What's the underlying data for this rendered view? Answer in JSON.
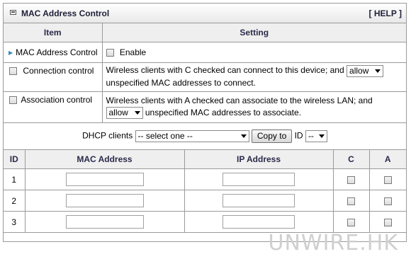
{
  "window": {
    "title": "MAC Address Control",
    "help": "[ HELP ]"
  },
  "config_table": {
    "headers": {
      "item": "Item",
      "setting": "Setting"
    },
    "mac_control": {
      "label": "MAC Address Control",
      "enable_label": "Enable"
    },
    "connection": {
      "label": "Connection control",
      "text_before": "Wireless clients with C checked can connect to this device; and",
      "select_value": "allow",
      "text_after": "unspecified MAC addresses to connect."
    },
    "association": {
      "label": "Association control",
      "text_before": "Wireless clients with A checked can associate to the wireless LAN; and",
      "select_value": "allow",
      "text_after": "unspecified MAC addresses to associate."
    },
    "dhcp": {
      "label": "DHCP clients",
      "select_value": "-- select one --",
      "copy_button": "Copy to",
      "id_label": "ID",
      "id_select": "--"
    }
  },
  "mac_table": {
    "headers": {
      "id": "ID",
      "mac": "MAC Address",
      "ip": "IP Address",
      "c": "C",
      "a": "A"
    },
    "rows": [
      {
        "id": "1",
        "mac": "",
        "ip": ""
      },
      {
        "id": "2",
        "mac": "",
        "ip": ""
      },
      {
        "id": "3",
        "mac": "",
        "ip": ""
      }
    ]
  },
  "watermark": "UNWIRE.HK"
}
